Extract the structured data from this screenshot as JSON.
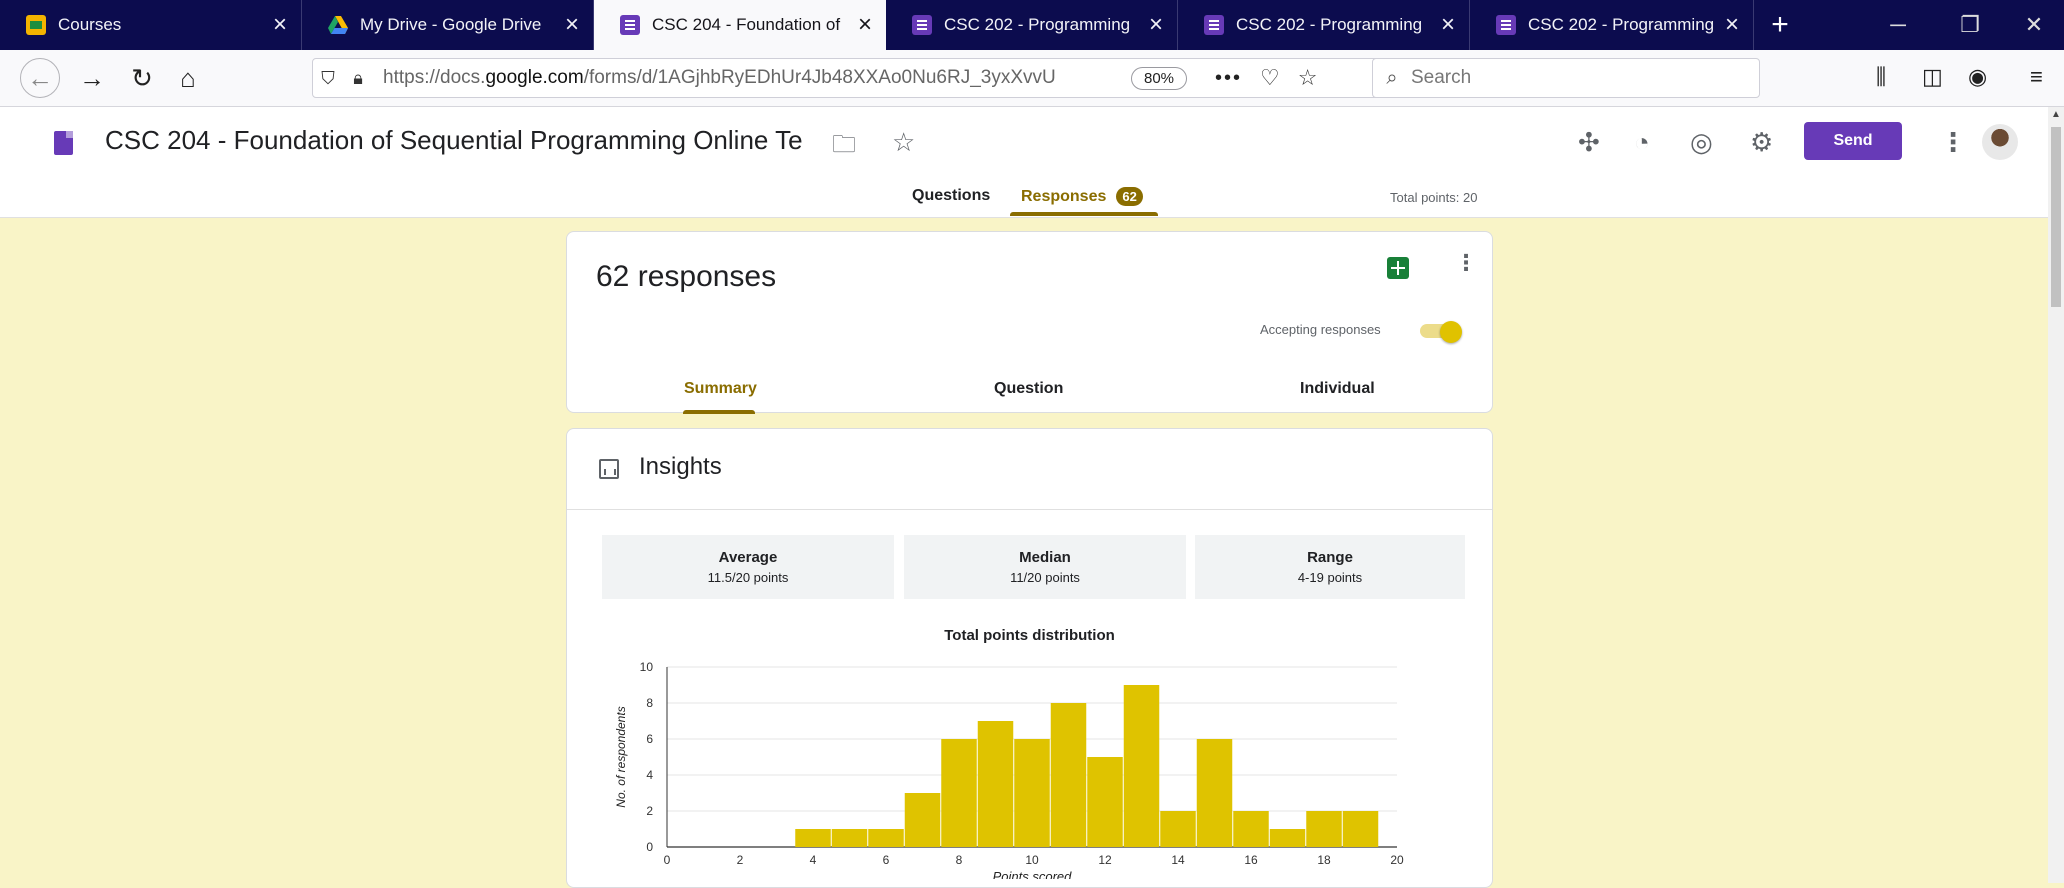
{
  "browser": {
    "tabs": [
      {
        "title": "Courses",
        "icon": "classroom-icon",
        "active": false
      },
      {
        "title": "My Drive - Google Drive",
        "icon": "drive-icon",
        "active": false
      },
      {
        "title": "CSC 204 - Foundation of",
        "icon": "forms-icon",
        "active": true
      },
      {
        "title": "CSC 202 - Programming",
        "icon": "forms-icon",
        "active": false
      },
      {
        "title": "CSC 202 - Programming",
        "icon": "forms-icon",
        "active": false
      },
      {
        "title": "CSC 202 - Programming",
        "icon": "forms-icon",
        "active": false
      }
    ],
    "url_prefix": "https://docs.",
    "url_domain": "google.com",
    "url_path": "/forms/d/1AGjhbRyEDhUr4Jb48XXAo0Nu6RJ_3yxXvvU",
    "zoom": "80%",
    "search_placeholder": "Search"
  },
  "form": {
    "title": "CSC 204 - Foundation of Sequential Programming Online Te",
    "send_label": "Send",
    "tab_questions": "Questions",
    "tab_responses": "Responses",
    "responses_badge": "62",
    "total_points": "Total points: 20"
  },
  "responses": {
    "count_label": "62 responses",
    "accepting_label": "Accepting responses",
    "accepting": true,
    "tabs": [
      "Summary",
      "Question",
      "Individual"
    ]
  },
  "insights": {
    "title": "Insights",
    "stats": [
      {
        "label": "Average",
        "value": "11.5/20 points"
      },
      {
        "label": "Median",
        "value": "11/20 points"
      },
      {
        "label": "Range",
        "value": "4-19 points"
      }
    ]
  },
  "chart_data": {
    "type": "bar",
    "title": "Total points distribution",
    "xlabel": "Points scored",
    "ylabel": "No. of respondents",
    "x": [
      4,
      5,
      6,
      7,
      8,
      9,
      10,
      11,
      12,
      13,
      14,
      15,
      16,
      17,
      18,
      19
    ],
    "values": [
      1,
      1,
      1,
      3,
      6,
      7,
      6,
      8,
      5,
      9,
      2,
      6,
      2,
      1,
      2,
      2
    ],
    "xlim": [
      0,
      20
    ],
    "ylim": [
      0,
      10
    ],
    "xticks": [
      0,
      2,
      4,
      6,
      8,
      10,
      12,
      14,
      16,
      18,
      20
    ],
    "yticks": [
      0,
      2,
      4,
      6,
      8,
      10
    ],
    "bar_color": "#dfc300",
    "grid": true
  },
  "colors": {
    "accent": "#673ab7",
    "theme_dark": "#8a6d00",
    "background": "#f9f4c7"
  }
}
